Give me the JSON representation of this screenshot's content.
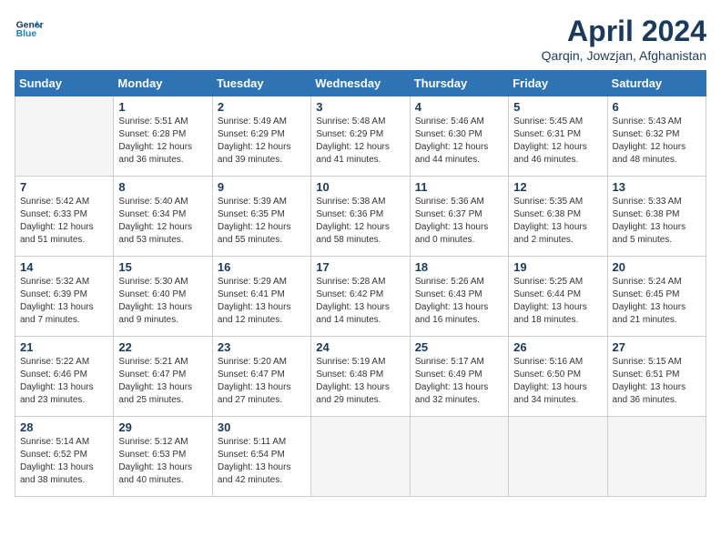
{
  "header": {
    "logo_line1": "General",
    "logo_line2": "Blue",
    "month_title": "April 2024",
    "location": "Qarqin, Jowzjan, Afghanistan"
  },
  "weekdays": [
    "Sunday",
    "Monday",
    "Tuesday",
    "Wednesday",
    "Thursday",
    "Friday",
    "Saturday"
  ],
  "weeks": [
    [
      {
        "day": "",
        "empty": true
      },
      {
        "day": "1",
        "sunrise": "5:51 AM",
        "sunset": "6:28 PM",
        "daylight": "12 hours and 36 minutes."
      },
      {
        "day": "2",
        "sunrise": "5:49 AM",
        "sunset": "6:29 PM",
        "daylight": "12 hours and 39 minutes."
      },
      {
        "day": "3",
        "sunrise": "5:48 AM",
        "sunset": "6:29 PM",
        "daylight": "12 hours and 41 minutes."
      },
      {
        "day": "4",
        "sunrise": "5:46 AM",
        "sunset": "6:30 PM",
        "daylight": "12 hours and 44 minutes."
      },
      {
        "day": "5",
        "sunrise": "5:45 AM",
        "sunset": "6:31 PM",
        "daylight": "12 hours and 46 minutes."
      },
      {
        "day": "6",
        "sunrise": "5:43 AM",
        "sunset": "6:32 PM",
        "daylight": "12 hours and 48 minutes."
      }
    ],
    [
      {
        "day": "7",
        "sunrise": "5:42 AM",
        "sunset": "6:33 PM",
        "daylight": "12 hours and 51 minutes."
      },
      {
        "day": "8",
        "sunrise": "5:40 AM",
        "sunset": "6:34 PM",
        "daylight": "12 hours and 53 minutes."
      },
      {
        "day": "9",
        "sunrise": "5:39 AM",
        "sunset": "6:35 PM",
        "daylight": "12 hours and 55 minutes."
      },
      {
        "day": "10",
        "sunrise": "5:38 AM",
        "sunset": "6:36 PM",
        "daylight": "12 hours and 58 minutes."
      },
      {
        "day": "11",
        "sunrise": "5:36 AM",
        "sunset": "6:37 PM",
        "daylight": "13 hours and 0 minutes."
      },
      {
        "day": "12",
        "sunrise": "5:35 AM",
        "sunset": "6:38 PM",
        "daylight": "13 hours and 2 minutes."
      },
      {
        "day": "13",
        "sunrise": "5:33 AM",
        "sunset": "6:38 PM",
        "daylight": "13 hours and 5 minutes."
      }
    ],
    [
      {
        "day": "14",
        "sunrise": "5:32 AM",
        "sunset": "6:39 PM",
        "daylight": "13 hours and 7 minutes."
      },
      {
        "day": "15",
        "sunrise": "5:30 AM",
        "sunset": "6:40 PM",
        "daylight": "13 hours and 9 minutes."
      },
      {
        "day": "16",
        "sunrise": "5:29 AM",
        "sunset": "6:41 PM",
        "daylight": "13 hours and 12 minutes."
      },
      {
        "day": "17",
        "sunrise": "5:28 AM",
        "sunset": "6:42 PM",
        "daylight": "13 hours and 14 minutes."
      },
      {
        "day": "18",
        "sunrise": "5:26 AM",
        "sunset": "6:43 PM",
        "daylight": "13 hours and 16 minutes."
      },
      {
        "day": "19",
        "sunrise": "5:25 AM",
        "sunset": "6:44 PM",
        "daylight": "13 hours and 18 minutes."
      },
      {
        "day": "20",
        "sunrise": "5:24 AM",
        "sunset": "6:45 PM",
        "daylight": "13 hours and 21 minutes."
      }
    ],
    [
      {
        "day": "21",
        "sunrise": "5:22 AM",
        "sunset": "6:46 PM",
        "daylight": "13 hours and 23 minutes."
      },
      {
        "day": "22",
        "sunrise": "5:21 AM",
        "sunset": "6:47 PM",
        "daylight": "13 hours and 25 minutes."
      },
      {
        "day": "23",
        "sunrise": "5:20 AM",
        "sunset": "6:47 PM",
        "daylight": "13 hours and 27 minutes."
      },
      {
        "day": "24",
        "sunrise": "5:19 AM",
        "sunset": "6:48 PM",
        "daylight": "13 hours and 29 minutes."
      },
      {
        "day": "25",
        "sunrise": "5:17 AM",
        "sunset": "6:49 PM",
        "daylight": "13 hours and 32 minutes."
      },
      {
        "day": "26",
        "sunrise": "5:16 AM",
        "sunset": "6:50 PM",
        "daylight": "13 hours and 34 minutes."
      },
      {
        "day": "27",
        "sunrise": "5:15 AM",
        "sunset": "6:51 PM",
        "daylight": "13 hours and 36 minutes."
      }
    ],
    [
      {
        "day": "28",
        "sunrise": "5:14 AM",
        "sunset": "6:52 PM",
        "daylight": "13 hours and 38 minutes."
      },
      {
        "day": "29",
        "sunrise": "5:12 AM",
        "sunset": "6:53 PM",
        "daylight": "13 hours and 40 minutes."
      },
      {
        "day": "30",
        "sunrise": "5:11 AM",
        "sunset": "6:54 PM",
        "daylight": "13 hours and 42 minutes."
      },
      {
        "day": "",
        "empty": true
      },
      {
        "day": "",
        "empty": true
      },
      {
        "day": "",
        "empty": true
      },
      {
        "day": "",
        "empty": true
      }
    ]
  ]
}
